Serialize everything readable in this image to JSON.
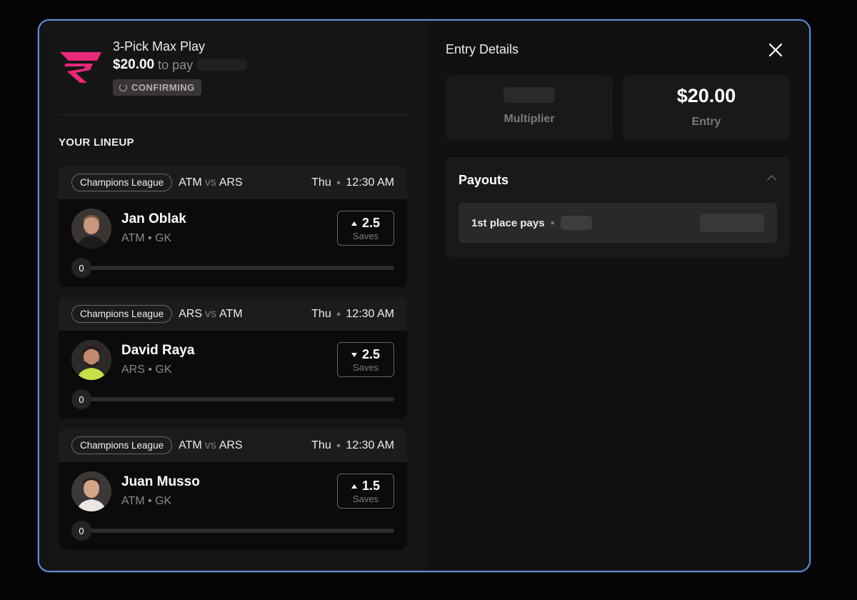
{
  "play": {
    "title": "3-Pick Max Play",
    "amount": "$20.00",
    "amount_suffix": "to pay",
    "status": "CONFIRMING"
  },
  "lineup": {
    "heading": "YOUR LINEUP",
    "picks": [
      {
        "league": "Champions League",
        "team_a": "ATM",
        "vs": "vs",
        "team_b": "ARS",
        "day": "Thu",
        "time": "12:30 AM",
        "player": "Jan Oblak",
        "meta": "ATM • GK",
        "direction": "up",
        "line": "2.5",
        "stat": "Saves",
        "progress_value": "0",
        "progress_fraction": 0
      },
      {
        "league": "Champions League",
        "team_a": "ARS",
        "vs": "vs",
        "team_b": "ATM",
        "day": "Thu",
        "time": "12:30 AM",
        "player": "David Raya",
        "meta": "ARS • GK",
        "direction": "down",
        "line": "2.5",
        "stat": "Saves",
        "progress_value": "0",
        "progress_fraction": 0
      },
      {
        "league": "Champions League",
        "team_a": "ATM",
        "vs": "vs",
        "team_b": "ARS",
        "day": "Thu",
        "time": "12:30 AM",
        "player": "Juan Musso",
        "meta": "ATM • GK",
        "direction": "up",
        "line": "1.5",
        "stat": "Saves",
        "progress_value": "0",
        "progress_fraction": 0
      }
    ]
  },
  "details": {
    "title": "Entry Details",
    "multiplier_label": "Multiplier",
    "entry_value": "$20.00",
    "entry_label": "Entry",
    "payouts_title": "Payouts",
    "payout_row_label": "1st place pays"
  },
  "colors": {
    "brand": "#e8297a",
    "modal_border": "#5b8fd6",
    "background": "#050505"
  }
}
